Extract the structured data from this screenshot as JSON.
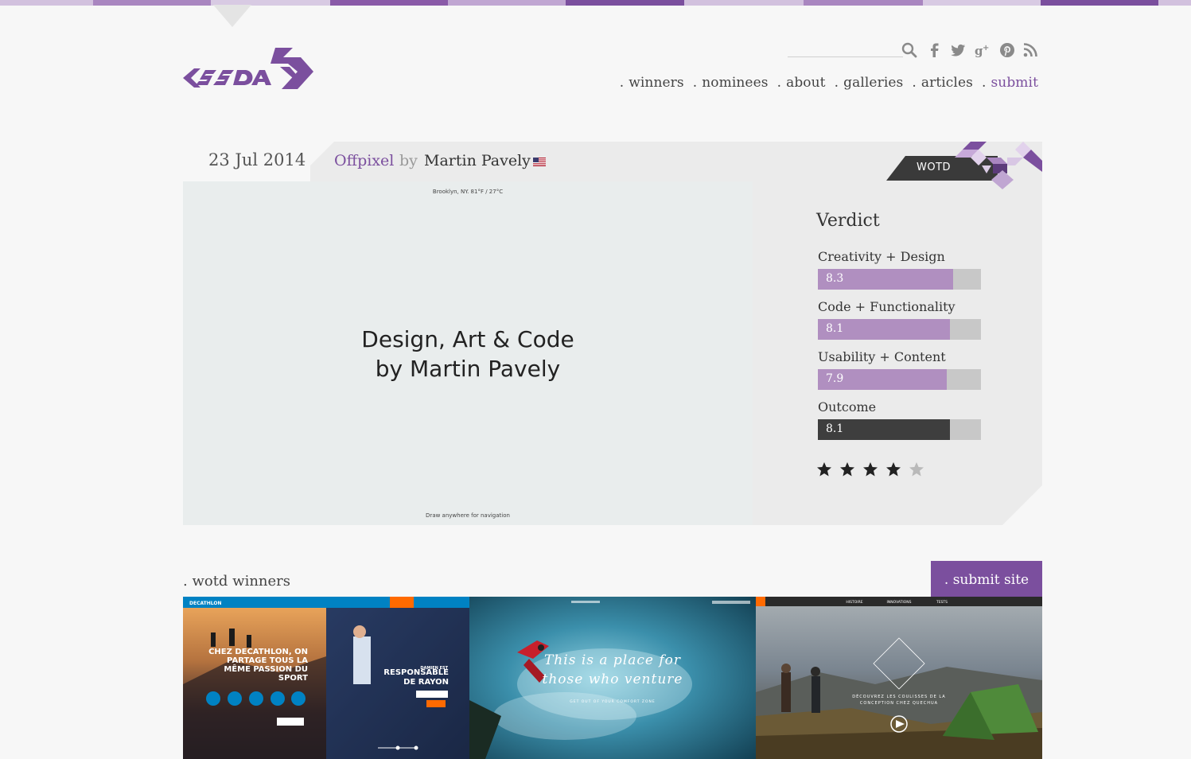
{
  "search": {
    "placeholder": ""
  },
  "social": [
    "search-icon",
    "facebook-icon",
    "twitter-icon",
    "google-plus-icon",
    "pinterest-icon",
    "rss-icon"
  ],
  "nav": [
    {
      "dot": ".",
      "label": "winners"
    },
    {
      "dot": ".",
      "label": "nominees"
    },
    {
      "dot": ".",
      "label": "about"
    },
    {
      "dot": ".",
      "label": "galleries"
    },
    {
      "dot": ".",
      "label": "articles"
    },
    {
      "dot": ".",
      "label": "submit"
    }
  ],
  "feature": {
    "date": "23 Jul 2014",
    "site_title": "Offpixel",
    "by": "by",
    "author": "Martin Pavely",
    "badge": "WOTD",
    "preview": {
      "weather": "Brooklyn, NY. 81°F / 27°C",
      "headline_line1": "Design, Art & Code",
      "headline_line2": "by Martin Pavely",
      "hint": "Draw anywhere for navigation"
    }
  },
  "verdict": {
    "title": "Verdict",
    "scores": [
      {
        "label": "Creativity + Design",
        "value": "8.3"
      },
      {
        "label": "Code + Functionality",
        "value": "8.1"
      },
      {
        "label": "Usability + Content",
        "value": "7.9"
      },
      {
        "label": "Outcome",
        "value": "8.1"
      }
    ],
    "stars_filled": 4,
    "stars_total": 5
  },
  "winners": {
    "title": ". wotd winners",
    "submit": ". submit site",
    "thumb1": {
      "brand": "DECATHLON",
      "left_text": "CHEZ DECATHLON, ON PARTAGE TOUS LA MÊME PASSION DU SPORT",
      "right_kicker": "DAMIEN EST",
      "right_text": "RESPONSABLE DE RAYON"
    },
    "thumb2": {
      "tagline": "This is a place for those who venture out",
      "sub": "GET OUT OF YOUR COMFORT ZONE"
    },
    "thumb3": {
      "nav": [
        "HISTOIRE",
        "INNOVATIONS",
        "TESTS"
      ],
      "caption": "DÉCOUVREZ LES COULISSES DE LA CONCEPTION CHEZ QUECHUA"
    }
  },
  "colors": {
    "accent": "#7b4f9e",
    "bar": "#b08fc0",
    "bar_dark": "#3e3e3e",
    "bar_track": "#c8c8c8"
  }
}
